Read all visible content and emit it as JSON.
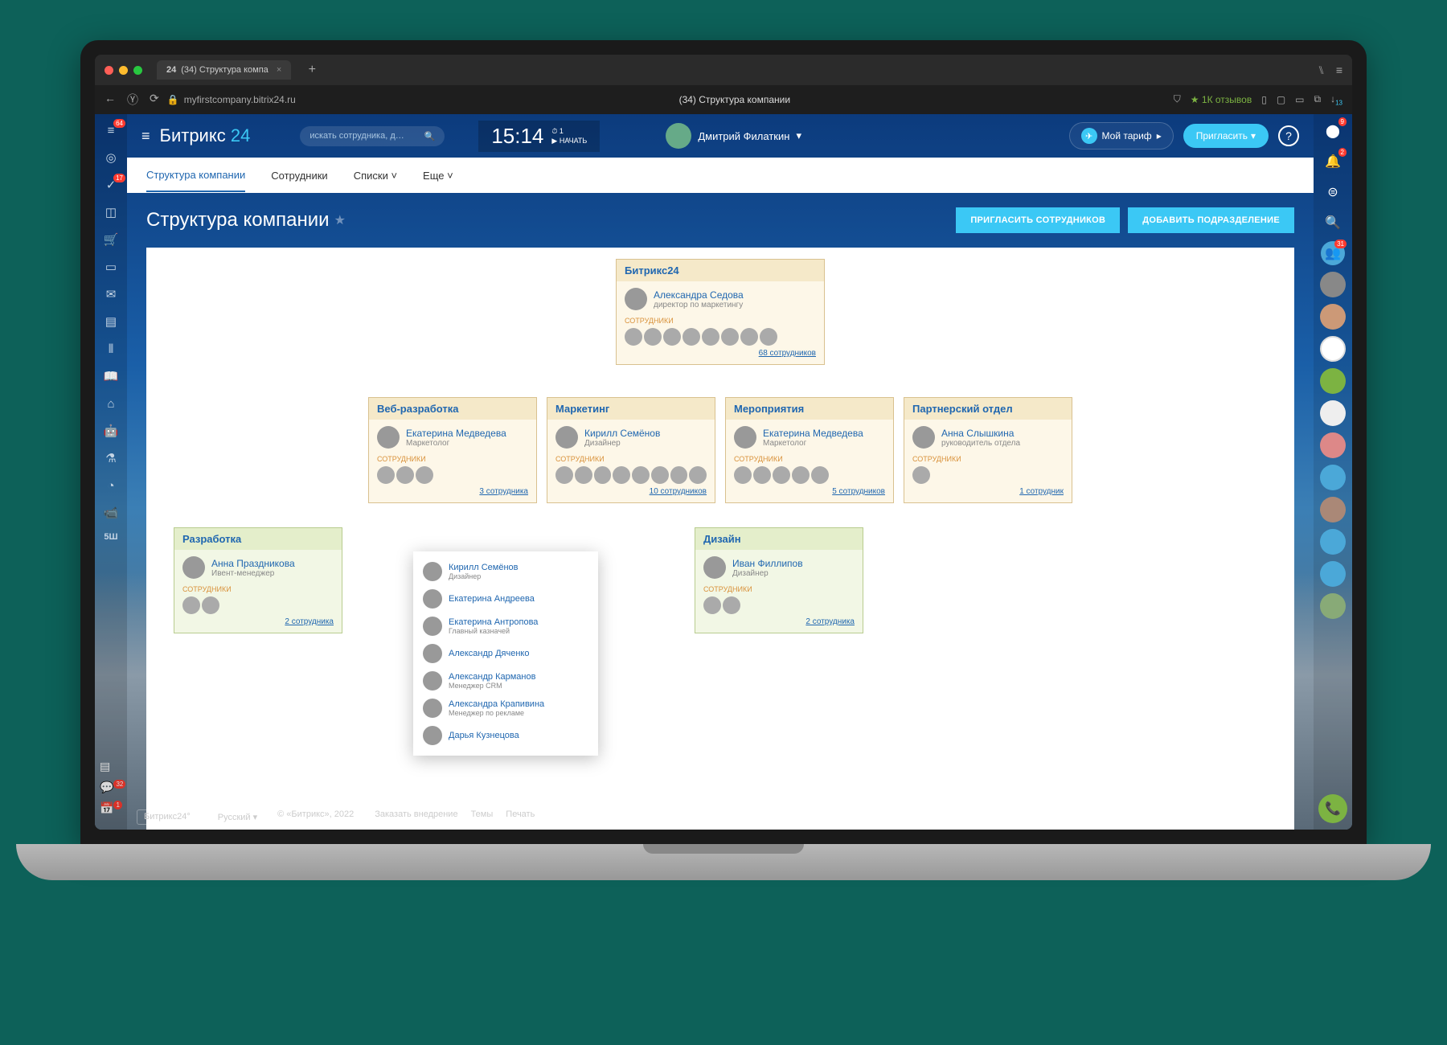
{
  "browser": {
    "tab_prefix": "24",
    "tab_title": "(34) Структура компа",
    "url": "myfirstcompany.bitrix24.ru",
    "page_title_bar": "(34) Структура компании",
    "reviews": "★ 1К отзывов"
  },
  "topbar": {
    "logo1": "Битрикс",
    "logo2": "24",
    "search_placeholder": "искать сотрудника, д…",
    "time": "15:14",
    "clock_secondary_1": "⏱ 1",
    "clock_secondary_2": "▶ НАЧАТЬ",
    "username": "Дмитрий Филаткин",
    "tariff": "Мой тариф",
    "invite": "Пригласить"
  },
  "left_rail": [
    {
      "icon": "≡",
      "badge": "64"
    },
    {
      "icon": "◎"
    },
    {
      "icon": "✓",
      "badge": "17"
    },
    {
      "icon": "◫"
    },
    {
      "icon": "🛒"
    },
    {
      "icon": "▭"
    },
    {
      "icon": "✉"
    },
    {
      "icon": "▤"
    },
    {
      "icon": "⫴"
    },
    {
      "icon": "📖"
    },
    {
      "icon": "⌂"
    },
    {
      "icon": "🤖"
    },
    {
      "icon": "⚗"
    },
    {
      "icon": "◔"
    },
    {
      "icon": "📹"
    }
  ],
  "left_rail_text": "5Ш",
  "right_rail_badges": {
    "top": "9",
    "bell": "2",
    "group": "31"
  },
  "tabs": [
    {
      "label": "Структура компании",
      "active": true
    },
    {
      "label": "Сотрудники",
      "active": false
    },
    {
      "label": "Списки",
      "active": false,
      "chevron": true
    },
    {
      "label": "Еще",
      "active": false,
      "chevron": true
    }
  ],
  "page_title": "Структура компании",
  "buttons": {
    "invite_emp": "ПРИГЛАСИТЬ СОТРУДНИКОВ",
    "add_dept": "ДОБАВИТЬ ПОДРАЗДЕЛЕНИЕ"
  },
  "labels": {
    "employees": "СОТРУДНИКИ"
  },
  "root": {
    "name": "Битрикс24",
    "lead": {
      "name": "Александра Седова",
      "role": "директор по маркетингу"
    },
    "avatars": 8,
    "link": "68 сотрудников"
  },
  "level2": [
    {
      "name": "Веб-разработка",
      "lead": {
        "name": "Екатерина Медведева",
        "role": "Маркетолог"
      },
      "avatars": 3,
      "link": "3 сотрудника"
    },
    {
      "name": "Маркетинг",
      "lead": {
        "name": "Кирилл Семёнов",
        "role": "Дизайнер"
      },
      "avatars": 8,
      "link": "10 сотрудников"
    },
    {
      "name": "Мероприятия",
      "lead": {
        "name": "Екатерина Медведева",
        "role": "Маркетолог"
      },
      "avatars": 5,
      "link": "5 сотрудников"
    },
    {
      "name": "Партнерский отдел",
      "lead": {
        "name": "Анна Слышкина",
        "role": "руководитель отдела"
      },
      "avatars": 1,
      "link": "1 сотрудник"
    }
  ],
  "level3": [
    {
      "name": "Разработка",
      "lead": {
        "name": "Анна Праздникова",
        "role": "Ивент-менеджер"
      },
      "avatars": 2,
      "link": "2 сотрудника"
    },
    {
      "name": "Дизайн",
      "lead": {
        "name": "Иван Филлипов",
        "role": "Дизайнер"
      },
      "avatars": 2,
      "link": "2 сотрудника"
    }
  ],
  "popup": [
    {
      "name": "Кирилл Семёнов",
      "role": "Дизайнер"
    },
    {
      "name": "Екатерина Андреева",
      "role": ""
    },
    {
      "name": "Екатерина Антропова",
      "role": "Главный казначей"
    },
    {
      "name": "Александр Дяченко",
      "role": ""
    },
    {
      "name": "Александр Карманов",
      "role": "Менеджер CRM"
    },
    {
      "name": "Александра Крапивина",
      "role": "Менеджер по рекламе"
    },
    {
      "name": "Дарья Кузнецова",
      "role": ""
    }
  ],
  "footer": {
    "brand": "Битрикс24°",
    "lang": "Русский ▾",
    "copy": "© «Битрикс», 2022",
    "order": "Заказать внедрение",
    "themes": "Темы",
    "print": "Печать"
  },
  "bottom_left_badges": {
    "chat": "32",
    "cal": "1"
  }
}
